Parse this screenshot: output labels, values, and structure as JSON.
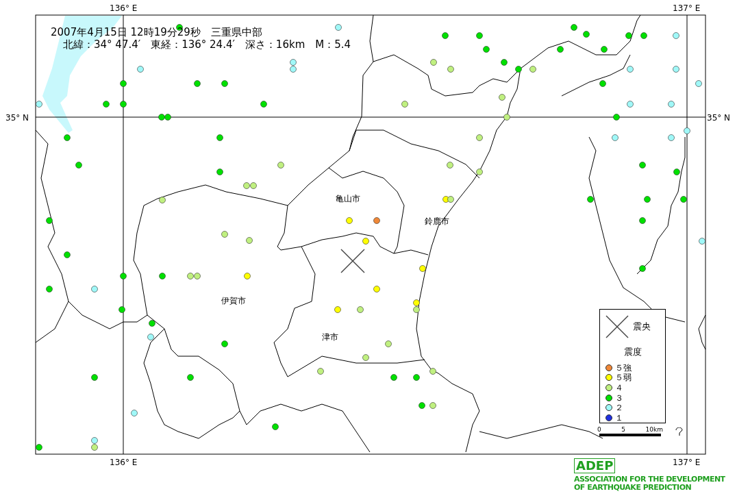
{
  "title": {
    "line_1": "2007年4月15日 12時19分29秒　三重県中部",
    "line_2": "北緯：34° 47.4′　東経：136° 24.4′　深さ：16km　M：5.4"
  },
  "axis_labels": {
    "top_left": "136° E",
    "top_right": "137° E",
    "left": "35° N",
    "right": "35° N",
    "bottom_left": "136° E",
    "bottom_right": "137° E"
  },
  "cities": [
    {
      "name": "亀山市"
    },
    {
      "name": "鈴鹿市"
    },
    {
      "name": "伊賀市"
    },
    {
      "name": "津市"
    }
  ],
  "stations": [
    {
      "color": "#a0f8f8"
    },
    {
      "color": "#00e000"
    },
    {
      "color": "#00e000"
    },
    {
      "color": "#00e000"
    },
    {
      "color": "#00e000"
    },
    {
      "color": "#00e000"
    },
    {
      "color": "#00e000"
    },
    {
      "color": "#a0f8f8"
    },
    {
      "color": "#00e000"
    },
    {
      "color": "#00e000"
    },
    {
      "color": "#00e000"
    },
    {
      "color": "#c0f080"
    },
    {
      "color": "#c0f080"
    },
    {
      "color": "#00e000"
    },
    {
      "color": "#00e000"
    },
    {
      "color": "#c0f080"
    },
    {
      "color": "#a0f8f8"
    },
    {
      "color": "#a0f8f8"
    },
    {
      "color": "#a0f8f8"
    },
    {
      "color": "#a0f8f8"
    },
    {
      "color": "#a0f8f8"
    },
    {
      "color": "#00e000"
    },
    {
      "color": "#00e000"
    },
    {
      "color": "#00e000"
    },
    {
      "color": "#00e000"
    },
    {
      "color": "#a0f8f8"
    },
    {
      "color": "#a0f8f8"
    },
    {
      "color": "#00e000"
    },
    {
      "color": "#00e000"
    },
    {
      "color": "#00e000"
    },
    {
      "color": "#c0f080"
    },
    {
      "color": "#c0f080"
    },
    {
      "color": "#a0f8f8"
    },
    {
      "color": "#a0f8f8"
    },
    {
      "color": "#00e000"
    },
    {
      "color": "#00e000"
    },
    {
      "color": "#c0f080"
    },
    {
      "color": "#00e000"
    },
    {
      "color": "#00e000"
    },
    {
      "color": "#00e000"
    },
    {
      "color": "#c0f080"
    },
    {
      "color": "#a0f8f8"
    },
    {
      "color": "#a0f8f8"
    },
    {
      "color": "#a0f8f8"
    },
    {
      "color": "#00e000"
    },
    {
      "color": "#00e000"
    },
    {
      "color": "#c0f080"
    },
    {
      "color": "#c0f080"
    },
    {
      "color": "#c0f080"
    },
    {
      "color": "#00e000"
    },
    {
      "color": "#00e000"
    },
    {
      "color": "#c0f080"
    },
    {
      "color": "#c0f080"
    },
    {
      "color": "#c0f080"
    },
    {
      "color": "#ffff00"
    },
    {
      "color": "#c0f080"
    },
    {
      "color": "#00e000"
    },
    {
      "color": "#00e000"
    },
    {
      "color": "#00e000"
    },
    {
      "color": "#00e000"
    },
    {
      "color": "#ffff00"
    },
    {
      "color": "#f08838"
    },
    {
      "color": "#00e000"
    },
    {
      "color": "#c0f080"
    },
    {
      "color": "#c0f080"
    },
    {
      "color": "#ffff00"
    },
    {
      "color": "#a0f8f8"
    },
    {
      "color": "#00e000"
    },
    {
      "color": "#ffff00"
    },
    {
      "color": "#00e000"
    },
    {
      "color": "#c0f080"
    },
    {
      "color": "#c0f080"
    },
    {
      "color": "#ffff00"
    },
    {
      "color": "#00e000"
    },
    {
      "color": "#00e000"
    },
    {
      "color": "#00e000"
    },
    {
      "color": "#a0f8f8"
    },
    {
      "color": "#ffff00"
    },
    {
      "color": "#ffff00"
    },
    {
      "color": "#c0f080"
    },
    {
      "color": "#ffff00"
    },
    {
      "color": "#c0f080"
    },
    {
      "color": "#00e000"
    },
    {
      "color": "#00e000"
    },
    {
      "color": "#a0f8f8"
    },
    {
      "color": "#00e000"
    },
    {
      "color": "#c0f080"
    },
    {
      "color": "#c0f080"
    },
    {
      "color": "#c0f080"
    },
    {
      "color": "#00e000"
    },
    {
      "color": "#00e000"
    },
    {
      "color": "#c0f080"
    },
    {
      "color": "#00e000"
    },
    {
      "color": "#00e000"
    },
    {
      "color": "#00e000"
    },
    {
      "color": "#c0f080"
    },
    {
      "color": "#a0f8f8"
    },
    {
      "color": "#a0f8f8"
    },
    {
      "color": "#c0f080"
    },
    {
      "color": "#00e000"
    },
    {
      "color": "#00e000"
    },
    {
      "color": "#00e000"
    }
  ],
  "legend": {
    "epicenter_label": "震央",
    "intensity_title": "震度",
    "items": [
      {
        "label": "５強",
        "color": "#f08838"
      },
      {
        "label": "５弱",
        "color": "#ffff00"
      },
      {
        "label": "４",
        "color": "#c0f080"
      },
      {
        "label": "３",
        "color": "#00e000"
      },
      {
        "label": "２",
        "color": "#a0f8f8"
      },
      {
        "label": "１",
        "color": "#2030e0"
      }
    ]
  },
  "scale_bar": {
    "ticks": [
      "0",
      "5",
      "10km"
    ]
  },
  "logo": {
    "mark": "ADEP",
    "line_1": "ASSOCIATION FOR THE DEVELOPMENT",
    "line_2": "OF EARTHQUAKE PREDICTION"
  }
}
